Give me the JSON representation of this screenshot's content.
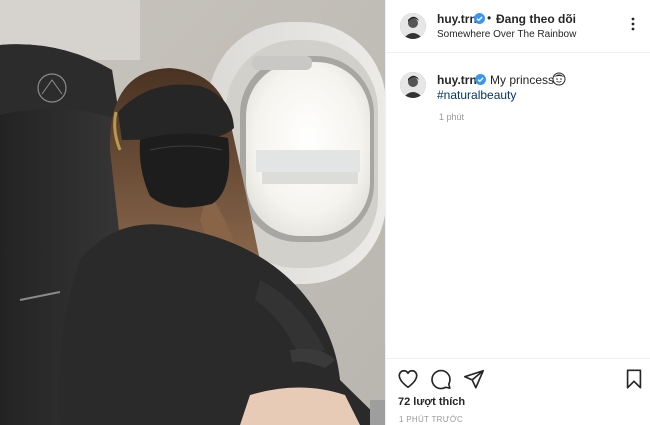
{
  "header": {
    "username": "huy.trn",
    "separator": "•",
    "follow_label": "Đang theo dõi",
    "location": "Somewhere Over The Rainbow"
  },
  "caption": {
    "username": "huy.trn",
    "text": "My princess",
    "emoji": "smiling-face-emoji",
    "hashtag": "#naturalbeauty",
    "time": "1 phút"
  },
  "actions": {
    "likes": "72 lượt thích",
    "time": "1 PHÚT TRƯỚC"
  },
  "colors": {
    "text": "#262626",
    "muted": "#999999",
    "hashtag": "#003569",
    "verified": "#3897f0",
    "divider": "#efefef"
  },
  "icons": [
    "verified-badge-icon",
    "more-options-icon",
    "heart-icon",
    "comment-icon",
    "share-icon",
    "bookmark-icon"
  ]
}
